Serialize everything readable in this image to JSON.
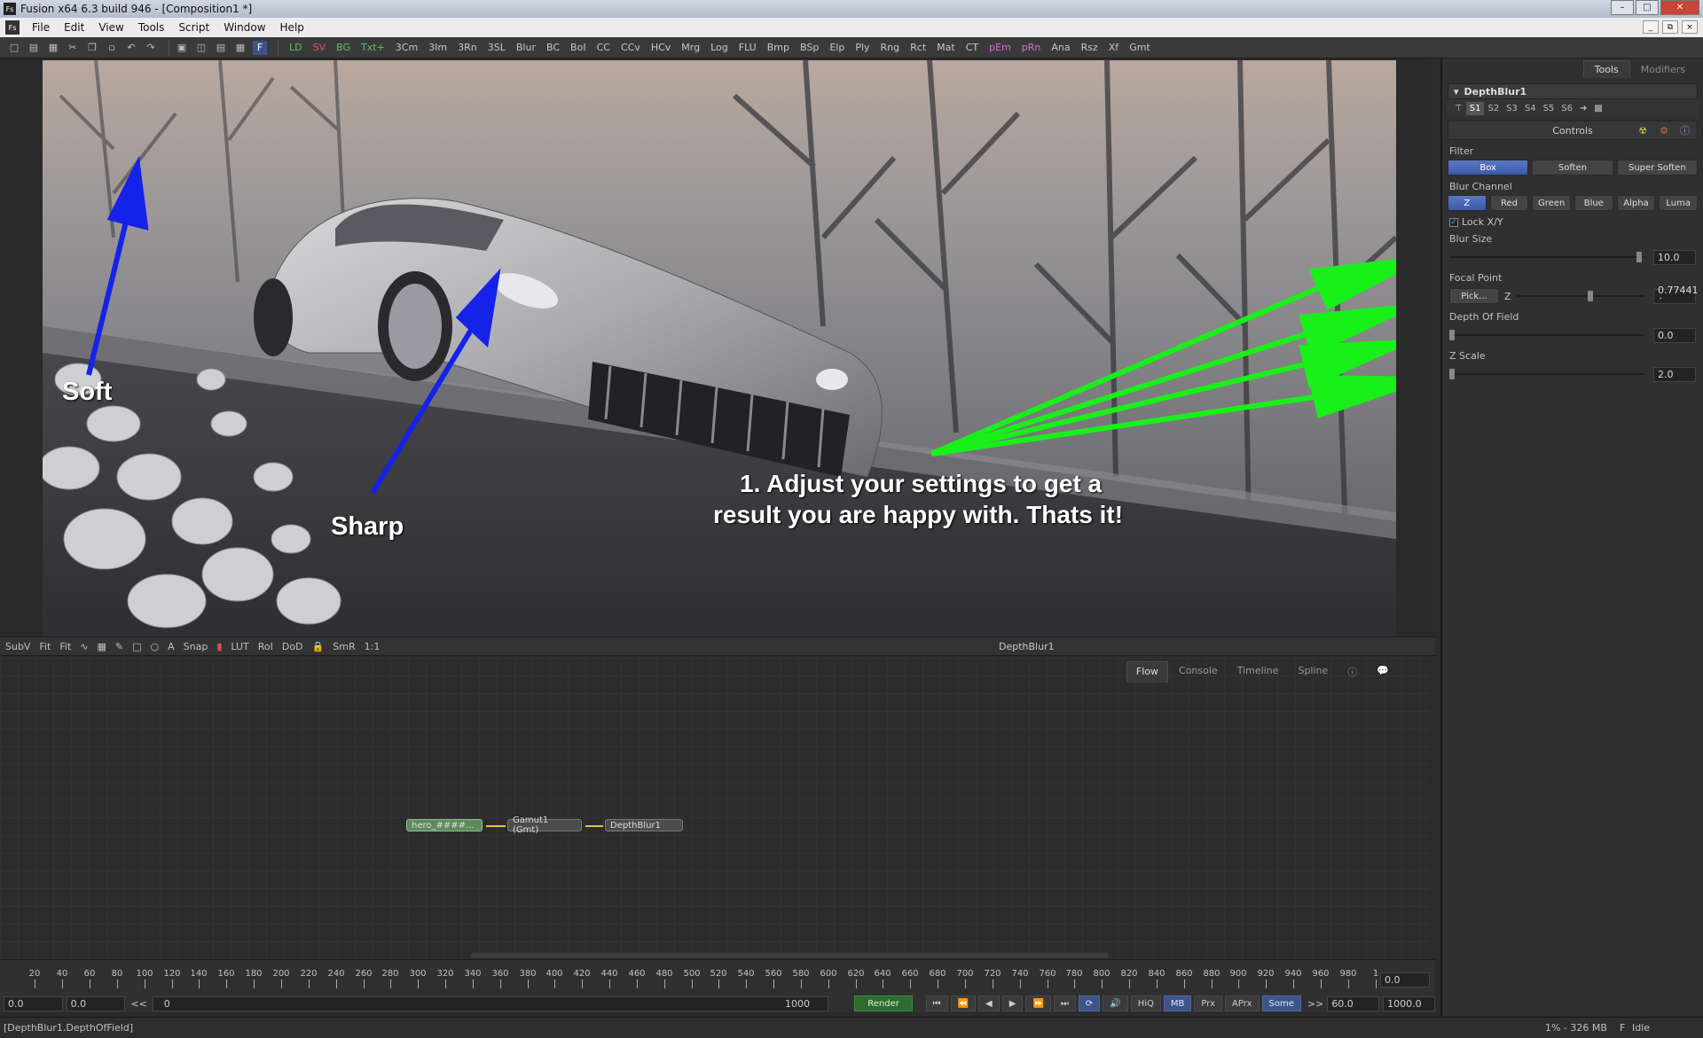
{
  "window": {
    "title": "Fusion x64 6.3 build 946 - [Composition1 *]",
    "app_icon": "Fs"
  },
  "menu": {
    "items": [
      "File",
      "Edit",
      "View",
      "Tools",
      "Script",
      "Window",
      "Help"
    ]
  },
  "toolbar": {
    "tools": [
      {
        "label": "LD",
        "color": "green"
      },
      {
        "label": "SV",
        "color": "red"
      },
      {
        "label": "BG",
        "color": "green"
      },
      {
        "label": "Txt+",
        "color": "green"
      },
      {
        "label": "3Cm",
        "color": "normal"
      },
      {
        "label": "3Im",
        "color": "normal"
      },
      {
        "label": "3Rn",
        "color": "normal"
      },
      {
        "label": "3SL",
        "color": "normal"
      },
      {
        "label": "Blur",
        "color": "normal"
      },
      {
        "label": "BC",
        "color": "normal"
      },
      {
        "label": "BoI",
        "color": "normal"
      },
      {
        "label": "CC",
        "color": "normal"
      },
      {
        "label": "CCv",
        "color": "normal"
      },
      {
        "label": "HCv",
        "color": "normal"
      },
      {
        "label": "Mrg",
        "color": "normal"
      },
      {
        "label": "Log",
        "color": "normal"
      },
      {
        "label": "FLU",
        "color": "normal"
      },
      {
        "label": "Bmp",
        "color": "normal"
      },
      {
        "label": "BSp",
        "color": "normal"
      },
      {
        "label": "Elp",
        "color": "normal"
      },
      {
        "label": "Ply",
        "color": "normal"
      },
      {
        "label": "Rng",
        "color": "normal"
      },
      {
        "label": "Rct",
        "color": "normal"
      },
      {
        "label": "Mat",
        "color": "normal"
      },
      {
        "label": "CT",
        "color": "normal"
      },
      {
        "label": "pEm",
        "color": "pink"
      },
      {
        "label": "pRn",
        "color": "pink"
      },
      {
        "label": "Ana",
        "color": "normal"
      },
      {
        "label": "Rsz",
        "color": "normal"
      },
      {
        "label": "Xf",
        "color": "normal"
      },
      {
        "label": "Gmt",
        "color": "normal"
      }
    ]
  },
  "viewer": {
    "annotations": {
      "soft": "Soft",
      "sharp": "Sharp",
      "instruction_line1": "1. Adjust your settings to get a",
      "instruction_line2": "result you are happy with. Thats it!"
    },
    "viewbar": {
      "items": [
        "SubV",
        "Fit",
        "Fit",
        "Snap",
        "LUT",
        "RoI",
        "DoD",
        "SmR",
        "1:1"
      ],
      "title": "DepthBlur1"
    }
  },
  "flow": {
    "tabs": [
      {
        "label": "Flow",
        "active": true
      },
      {
        "label": "Console",
        "active": false
      },
      {
        "label": "Timeline",
        "active": false
      },
      {
        "label": "Spline",
        "active": false
      }
    ],
    "nodes": {
      "loader": "hero_####...",
      "gamut": "Gamut1 (Gmt)",
      "depthblur": "DepthBlur1"
    }
  },
  "timeline": {
    "ticks": [
      "20",
      "40",
      "60",
      "80",
      "100",
      "120",
      "140",
      "160",
      "180",
      "200",
      "220",
      "240",
      "260",
      "280",
      "300",
      "320",
      "340",
      "360",
      "380",
      "400",
      "420",
      "440",
      "460",
      "480",
      "500",
      "520",
      "540",
      "560",
      "580",
      "600",
      "620",
      "640",
      "660",
      "680",
      "700",
      "720",
      "740",
      "760",
      "780",
      "800",
      "820",
      "840",
      "860",
      "880",
      "900",
      "920",
      "940",
      "960",
      "980",
      "1"
    ],
    "right_value": "0.0",
    "render_start": "0.0",
    "global_start": "0.0",
    "back_label": "<<",
    "current": "0",
    "end_current": "1000",
    "render_label": "Render",
    "buttons": [
      "HiQ",
      "MB",
      "Prx",
      "APrx",
      "Some"
    ],
    "fwd_label": ">>",
    "render_end": "60.0",
    "global_end": "1000.0"
  },
  "status": {
    "left": "[DepthBlur1.DepthOfField]",
    "memory": "1% - 326 MB",
    "state": "Idle"
  },
  "panel": {
    "tabs": [
      {
        "label": "Tools",
        "active": true
      },
      {
        "label": "Modifiers",
        "active": false
      }
    ],
    "tool_name": "DepthBlur1",
    "slots": [
      "S1",
      "S2",
      "S3",
      "S4",
      "S5",
      "S6"
    ],
    "controls_label": "Controls",
    "filter": {
      "label": "Filter",
      "options": [
        {
          "label": "Box",
          "active": true
        },
        {
          "label": "Soften",
          "active": false
        },
        {
          "label": "Super Soften",
          "active": false
        }
      ]
    },
    "blur_channel": {
      "label": "Blur Channel",
      "options": [
        {
          "label": "Z",
          "active": true
        },
        {
          "label": "Red",
          "active": false
        },
        {
          "label": "Green",
          "active": false
        },
        {
          "label": "Blue",
          "active": false
        },
        {
          "label": "Alpha",
          "active": false
        },
        {
          "label": "Luma",
          "active": false
        }
      ]
    },
    "lock_xy": "Lock X/Y",
    "blur_size": {
      "label": "Blur Size",
      "value": "10.0"
    },
    "focal_point": {
      "label": "Focal Point",
      "pick": "Pick...",
      "axis": "Z",
      "value": "0.77441´"
    },
    "depth_of_field": {
      "label": "Depth Of Field",
      "value": "0.0"
    },
    "z_scale": {
      "label": "Z Scale",
      "value": "2.0"
    }
  },
  "colors": {
    "annotation_blue": "#1522e8",
    "annotation_green": "#19f019",
    "accent_blue": "#4a66b8",
    "render_green": "#2f6b2f"
  }
}
